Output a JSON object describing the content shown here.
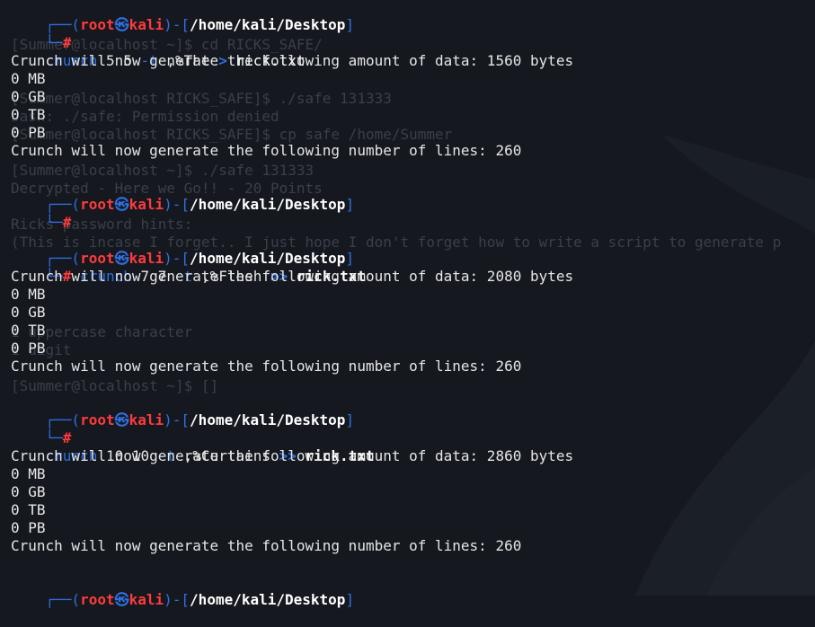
{
  "prompt": {
    "tl": "┌──(",
    "user": "root",
    "skull": "㉿",
    "host": "kali",
    "mid": ")-[",
    "path": "/home/kali/Desktop",
    "close": "]",
    "bl": "└─",
    "hash": "#"
  },
  "cmd1": {
    "bin": "crunch",
    "args": " 5 5 ",
    "opt": "-t",
    "pat": " ,%The ",
    "redir": ">",
    "file": " rick.txt"
  },
  "cmd2": {
    "bin": "crunch",
    "args": " 7 7 ",
    "opt": "-t",
    "pat": " ,%Flesh ",
    "redir": ">>",
    "file": " rick.txt"
  },
  "cmd3": {
    "bin": "crunch",
    "args": " 10 10 ",
    "opt": "-t",
    "pat": " ,%Curtains ",
    "redir": ">>",
    "file": " rick.txt"
  },
  "out1": {
    "data": "Crunch will now generate the following amount of data: 1560 bytes",
    "mb": "0 MB",
    "gb": "0 GB",
    "tb": "0 TB",
    "pb": "0 PB",
    "lines": "Crunch will now generate the following number of lines: 260"
  },
  "out2": {
    "data": "Crunch will now generate the following amount of data: 2080 bytes",
    "mb": "0 MB",
    "gb": "0 GB",
    "tb": "0 TB",
    "pb": "0 PB",
    "lines": "Crunch will now generate the following number of lines: 260"
  },
  "out3": {
    "data": "Crunch will now generate the following amount of data: 2860 bytes",
    "mb": "0 MB",
    "gb": "0 GB",
    "tb": "0 TB",
    "pb": "0 PB",
    "lines": "Crunch will now generate the following number of lines: 260"
  },
  "ghost": {
    "g1": "[Summer@localhost ~]$ cd RICKS_SAFE/",
    "g2": "[Summer@localhost RICKS_SAFE]$ ./safe 131333",
    "g3": "bash: ./safe: Permission denied",
    "g4": "[Summer@localhost RICKS_SAFE]$ cp safe /home/Summer",
    "g5": "[Summer@localhost ~]$ ./safe 131333",
    "g6": "Decrypted - Here we Go!! - 20 Points",
    "g7": "Ricks password hints:",
    "g8": "(This is incase I forget.. I just hope I don't forget how to write a script to generate p",
    "g9": "1 uppercase character",
    "g10": "1 digit",
    "g11": "[Summer@localhost ~]$ []"
  },
  "colors": {
    "background": "#15181f",
    "prompt_frame": "#2f6fe0",
    "user_host": "#ff3b3b",
    "text": "#e6e6e6"
  }
}
